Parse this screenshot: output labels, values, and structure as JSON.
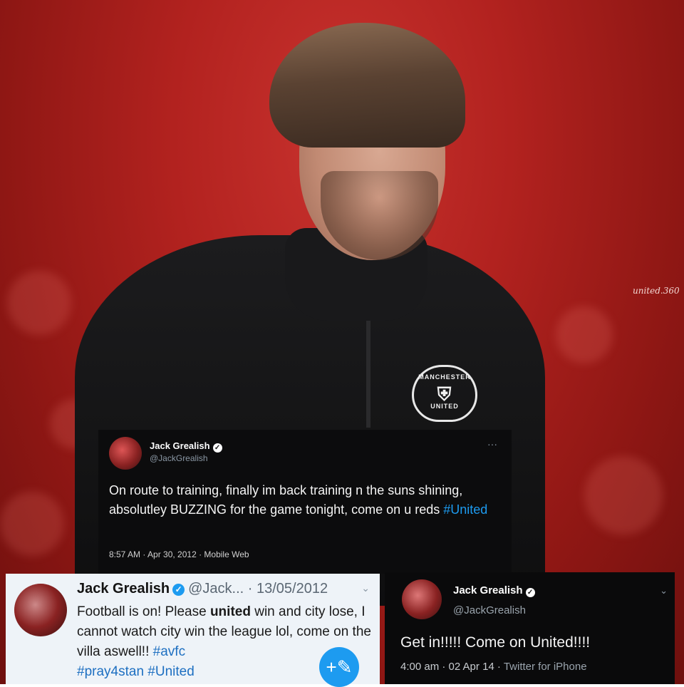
{
  "watermark": "united.360",
  "crest": {
    "top": "MANCHESTER",
    "bottom": "UNITED"
  },
  "tweet1": {
    "name": "Jack Grealish",
    "handle": "@JackGrealish",
    "more": "···",
    "text_before": "On route to training, finally im back training n the suns shining, absolutley BUZZING for the game tonight, come on u reds ",
    "hashtag": "#United",
    "meta": "8:57 AM · Apr 30, 2012 · Mobile Web"
  },
  "tweet2": {
    "name": "Jack Grealish",
    "handle": "@Jack...",
    "date": "· 13/05/2012",
    "chevron": "⌄",
    "t_a": "Football is on! Please ",
    "t_b": "united",
    "t_c": " win and city lose, I cannot watch city win the league lol, come on the villa aswell!! ",
    "h1": "#avfc",
    "h2": "#pray4stan",
    "h3": "#United",
    "fab": "+✎"
  },
  "tweet3": {
    "name": "Jack Grealish",
    "handle": "@JackGrealish",
    "chevron": "⌄",
    "text": "Get in!!!!! Come on United!!!!",
    "meta": "4:00 am · 02 Apr 14 · ",
    "source": "Twitter for iPhone"
  },
  "icons": {
    "verified": "verified-badge-icon",
    "compose": "compose-icon"
  },
  "colors": {
    "background": "#b2221f",
    "link": "#1d9bf0",
    "tweet_dark": "#0c0c0d",
    "tweet_light": "#eef3f8"
  }
}
